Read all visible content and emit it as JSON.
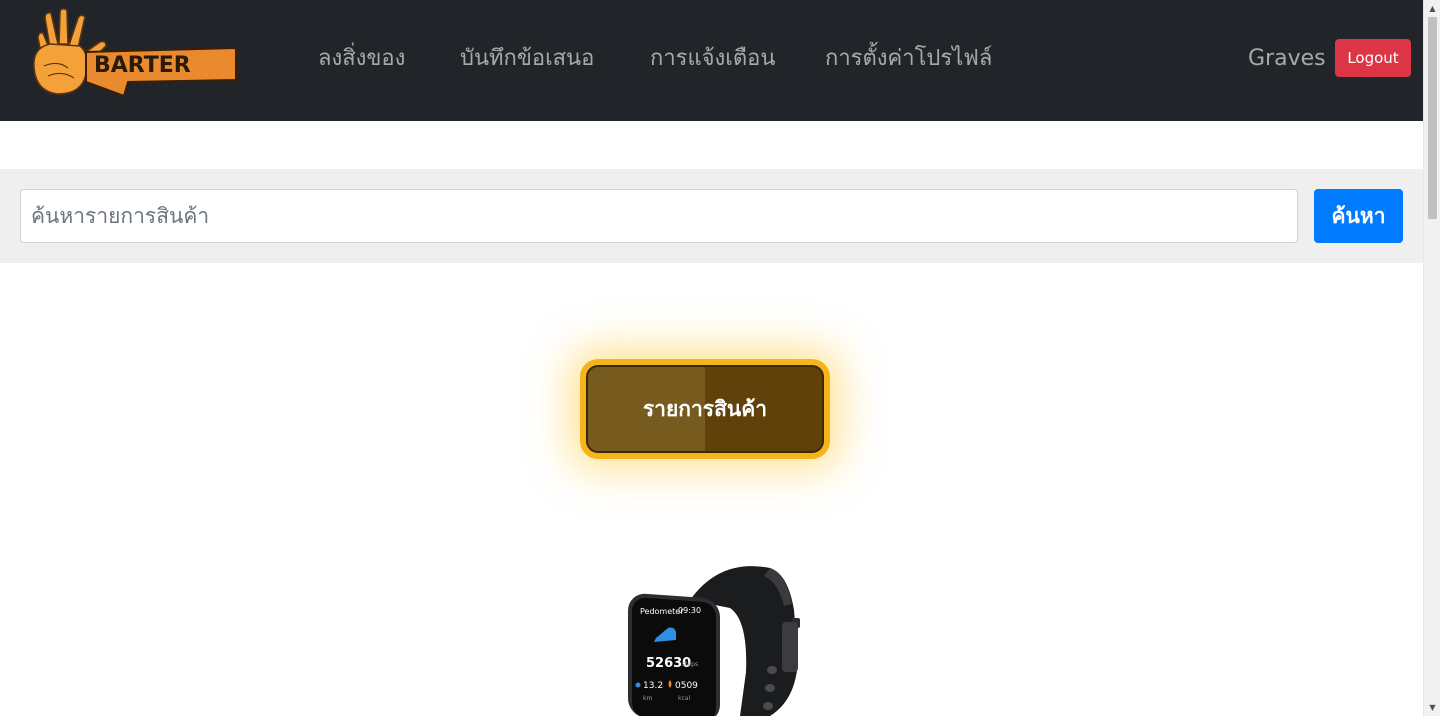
{
  "brand": {
    "name": "BARTER",
    "accent": "#e98a2f"
  },
  "nav": {
    "items": [
      {
        "label": "ลงสิ่งของ"
      },
      {
        "label": "บันทึกข้อเสนอ"
      },
      {
        "label": "การแจ้งเตือน"
      },
      {
        "label": "การตั้งค่าโปรไฟล์"
      }
    ],
    "user": "Graves",
    "logout_label": "Logout"
  },
  "search": {
    "placeholder": "ค้นหารายการสินค้า",
    "value": "",
    "button_label": "ค้นหา"
  },
  "products": {
    "title": "รายการสินค้า",
    "items": [
      {
        "image": "smartwatch",
        "screen": {
          "mode": "Pedometer",
          "time": "09:30",
          "steps": "52630",
          "steps_unit": "steps",
          "distance": "13.2",
          "distance_unit": "km",
          "calories": "0509",
          "calories_unit": "kcal"
        }
      }
    ]
  },
  "colors": {
    "navbar": "#212529",
    "logout": "#dc3545",
    "search_button": "#007bff",
    "title_border": "#f4b51c"
  }
}
